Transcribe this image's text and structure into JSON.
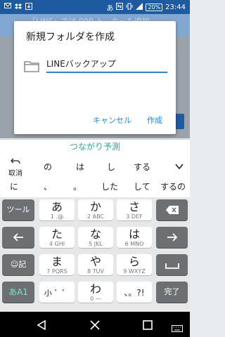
{
  "status": {
    "left_icons": [
      "mail-icon",
      "dropbox-icon",
      "download-icon"
    ],
    "ime_indicator": "あ",
    "battery": "20%",
    "time": "23:44"
  },
  "background": {
    "text": "「LINE」では 000 ト...カーも追加..."
  },
  "dialog": {
    "title": "新規フォルダを作成",
    "folder_name_value": "LINEバックアップ",
    "cancel_label": "キャンセル",
    "create_label": "作成"
  },
  "prediction": {
    "label": "つながり予測"
  },
  "candidates": {
    "undo_label": "取消",
    "row1": [
      "の",
      "は",
      "し",
      "する"
    ],
    "row2": [
      "に",
      "、",
      "。",
      "した",
      "して",
      "するの"
    ]
  },
  "keyboard": {
    "tool_label": "ツール",
    "emoji_label": "☺記",
    "mode_label": "あA1",
    "done_label": "完了",
    "keys": [
      {
        "main": "あ",
        "sub": "1 .@"
      },
      {
        "main": "か",
        "sub": "2 ABC"
      },
      {
        "main": "さ",
        "sub": "3 DEF"
      },
      {
        "main": "た",
        "sub": "4 GHI"
      },
      {
        "main": "な",
        "sub": "5 JKL"
      },
      {
        "main": "は",
        "sub": "6 MNO"
      },
      {
        "main": "ま",
        "sub": "7 PQRS"
      },
      {
        "main": "や",
        "sub": "8 TUV"
      },
      {
        "main": "ら",
        "sub": "9 WXYZ"
      },
      {
        "main": "小 ゛゜",
        "sub": ""
      },
      {
        "main": "わ",
        "sub": "0 ―"
      },
      {
        "main": "、。?!",
        "sub": ""
      }
    ]
  }
}
